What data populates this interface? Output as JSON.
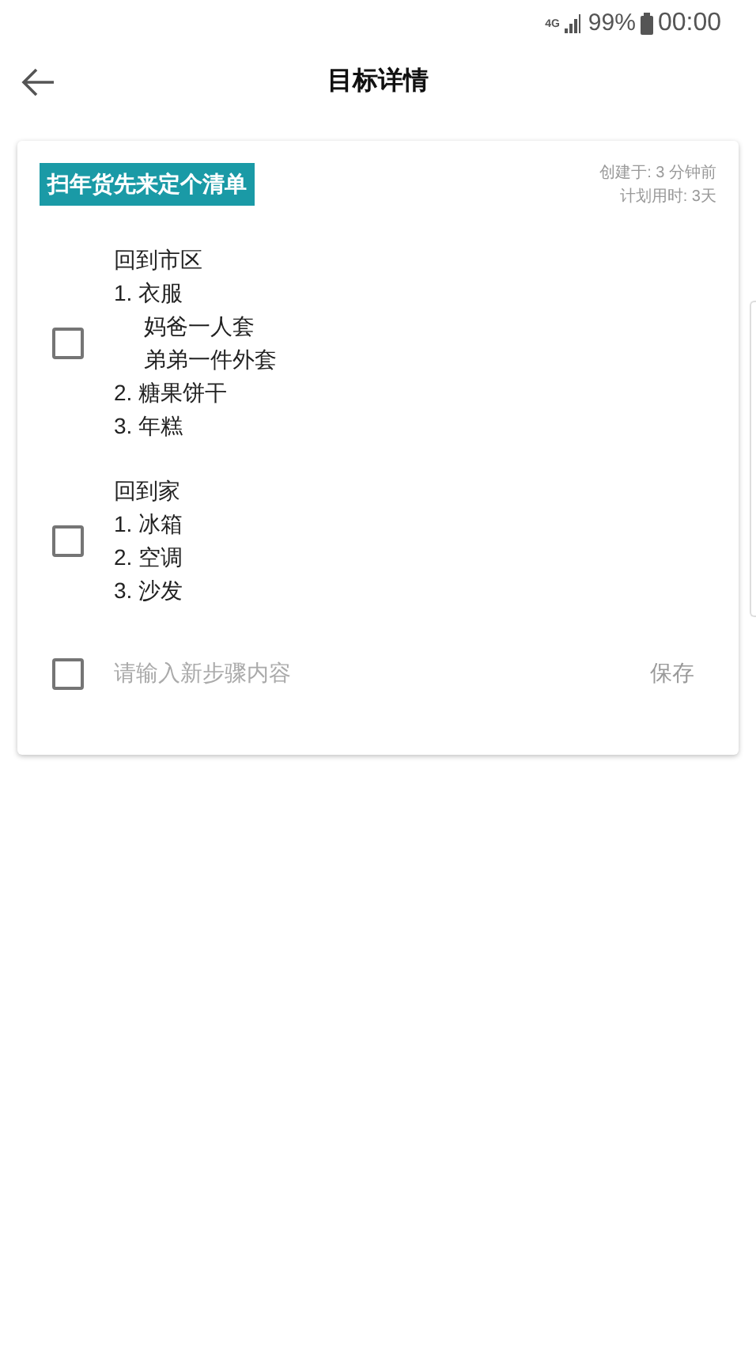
{
  "status_bar": {
    "network": "4G",
    "battery": "99%",
    "time": "00:00"
  },
  "header": {
    "title": "目标详情"
  },
  "goal": {
    "tag": "扫年货先来定个清单",
    "created": "创建于: 3 分钟前",
    "planned": "计划用时: 3天"
  },
  "steps": [
    {
      "checked": false,
      "lines": [
        {
          "text": "回到市区"
        },
        {
          "text": "1. 衣服",
          "children": [
            {
              "text": "妈爸一人套"
            },
            {
              "text": "弟弟一件外套"
            }
          ]
        },
        {
          "text": "2. 糖果饼干"
        },
        {
          "text": "3. 年糕"
        }
      ]
    },
    {
      "checked": false,
      "lines": [
        {
          "text": "回到家"
        },
        {
          "text": "1. 冰箱"
        },
        {
          "text": "2. 空调"
        },
        {
          "text": "3. 沙发"
        }
      ]
    }
  ],
  "new_step": {
    "checked": false,
    "placeholder": "请输入新步骤内容",
    "save": "保存"
  }
}
